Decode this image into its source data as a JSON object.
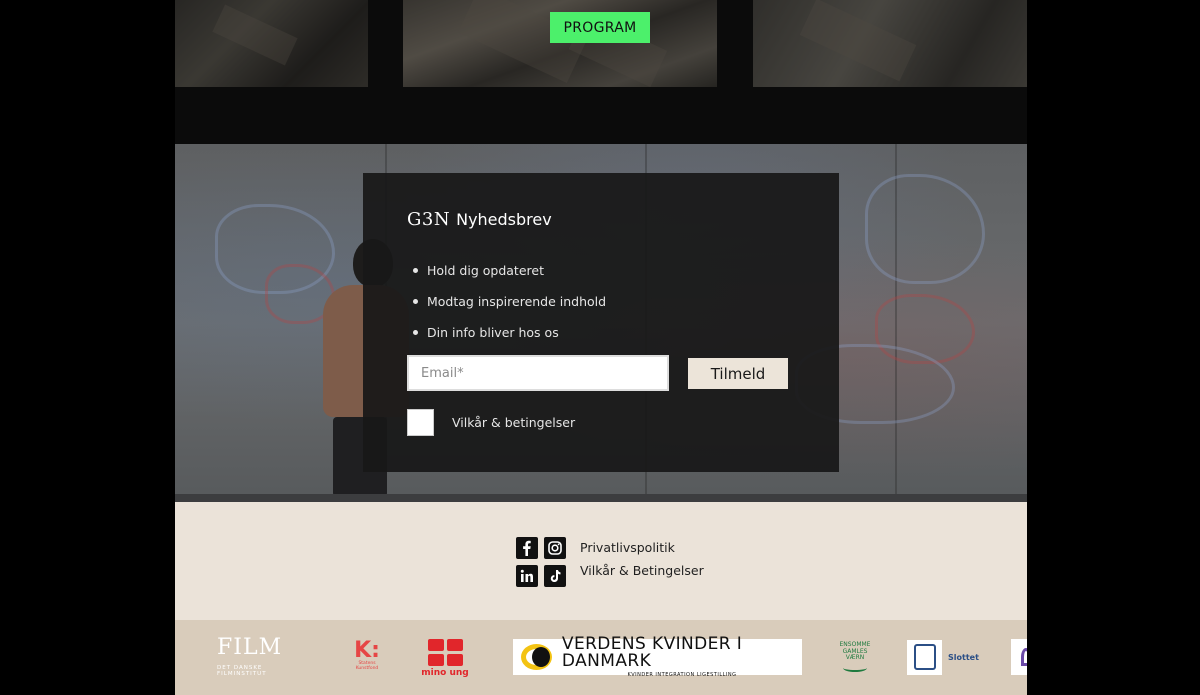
{
  "program_button": {
    "label": "PROGRAM"
  },
  "newsletter": {
    "logo": "G3N",
    "title": "Nyhedsbrev",
    "bullets": [
      "Hold dig opdateret",
      "Modtag inspirerende indhold",
      "Din info bliver hos os"
    ],
    "email_placeholder": "Email*",
    "submit_label": "Tilmeld",
    "terms_label": "Vilkår & betingelser"
  },
  "footer": {
    "socials": [
      "facebook-icon",
      "instagram-icon",
      "linkedin-icon",
      "tiktok-icon"
    ],
    "links": [
      "Privatlivspolitik",
      "Vilkår & Betingelser"
    ]
  },
  "partners": {
    "fila": {
      "mark": "FILM",
      "sub": "DET DANSKE FILMINSTITUT"
    },
    "kunstfond": {
      "mark": "K:",
      "sub": "Statens Kunstfond"
    },
    "mino": {
      "label": "mino ung"
    },
    "vkid": {
      "main": "VERDENS KVINDER I DANMARK",
      "sub": "KVINDER INTEGRATION LIGESTILLING"
    },
    "ensomme": {
      "label": "ENSOMME GAMLES VÆRN"
    },
    "slottet": {
      "label": "Slottet"
    }
  },
  "colors": {
    "program_green": "#4cf06b",
    "footer_bg": "#ebe3d9",
    "partners_bg": "#d9ccbb",
    "submit_bg": "#ece4d9"
  }
}
